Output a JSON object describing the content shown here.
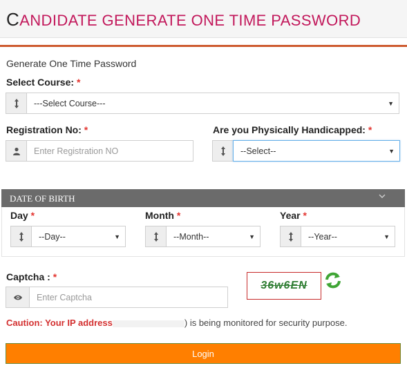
{
  "header": {
    "title_first": "C",
    "title_rest": "ANDIDATE GENERATE ONE TIME PASSWORD"
  },
  "form": {
    "subtitle": "Generate One Time Password",
    "required_mark": "*",
    "course": {
      "label": "Select Course:",
      "selected": "---Select Course---",
      "icon": "up-down-arrow-icon"
    },
    "registration": {
      "label": "Registration No:",
      "placeholder": "Enter Registration NO",
      "icon": "user-icon"
    },
    "handicapped": {
      "label": "Are you Physically Handicapped:",
      "selected": "--Select--",
      "icon": "up-down-arrow-icon"
    },
    "dob": {
      "title": "Date of Birth",
      "day": {
        "label": "Day",
        "selected": "--Day--"
      },
      "month": {
        "label": "Month",
        "selected": "--Month--"
      },
      "year": {
        "label": "Year",
        "selected": "--Year--"
      }
    },
    "captcha": {
      "label": "Captcha :",
      "placeholder": "Enter Captcha",
      "image_text": "36w6EN",
      "icon": "eye-icon",
      "refresh_icon": "refresh-icon"
    },
    "caution": {
      "warning": "Caution: Your IP address",
      "rest": ") is being monitored for security purpose."
    },
    "login_label": "Login"
  },
  "colors": {
    "title": "#c2185b",
    "rule": "#cd5a2e",
    "required": "#e3342f",
    "dob_bar": "#6b6b6b",
    "login": "#ff7f00",
    "captcha_text": "#2e7d32"
  }
}
